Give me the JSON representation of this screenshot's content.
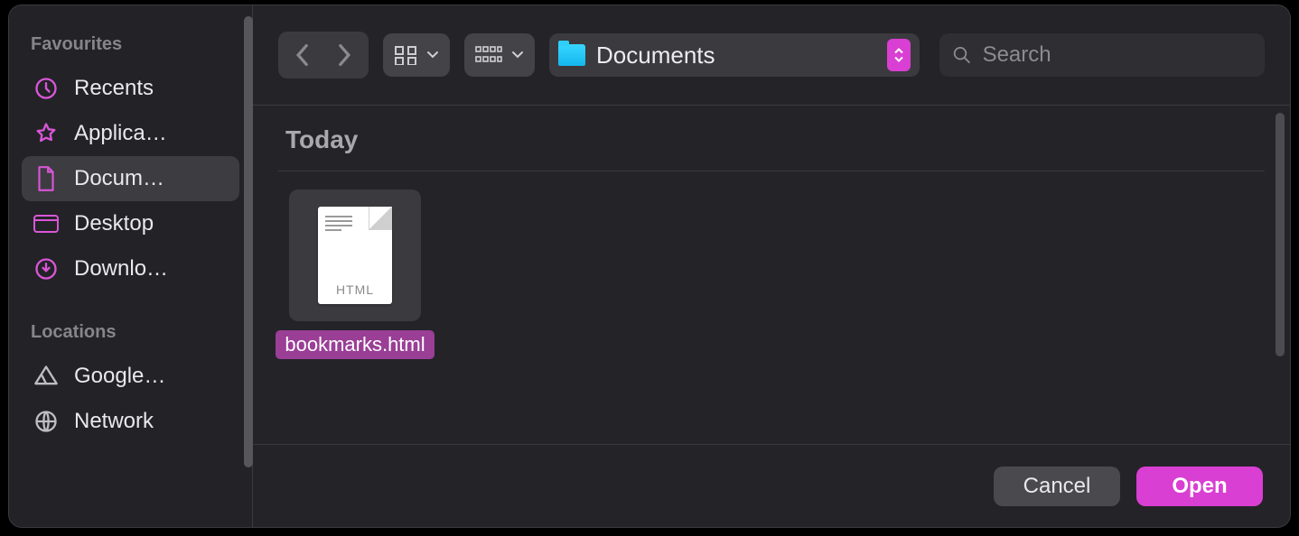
{
  "sidebar": {
    "sections": [
      {
        "label": "Favourites",
        "items": [
          {
            "icon": "clock-icon",
            "label": "Recents",
            "selected": false
          },
          {
            "icon": "apps-icon",
            "label": "Applica…",
            "selected": false
          },
          {
            "icon": "document-icon",
            "label": "Docum…",
            "selected": true
          },
          {
            "icon": "desktop-icon",
            "label": "Desktop",
            "selected": false
          },
          {
            "icon": "download-icon",
            "label": "Downlo…",
            "selected": false
          }
        ]
      },
      {
        "label": "Locations",
        "items": [
          {
            "icon": "drive-icon",
            "label": "Google…",
            "selected": false
          },
          {
            "icon": "network-icon",
            "label": "Network",
            "selected": false
          }
        ]
      }
    ]
  },
  "toolbar": {
    "location_label": "Documents",
    "search_placeholder": "Search"
  },
  "file_area": {
    "group_label": "Today",
    "items": [
      {
        "name": "bookmarks.html",
        "ext_label": "HTML",
        "selected": true
      }
    ]
  },
  "footer": {
    "cancel_label": "Cancel",
    "open_label": "Open"
  },
  "colors": {
    "accent": "#d93fd2",
    "selection": "#9a3e96"
  }
}
